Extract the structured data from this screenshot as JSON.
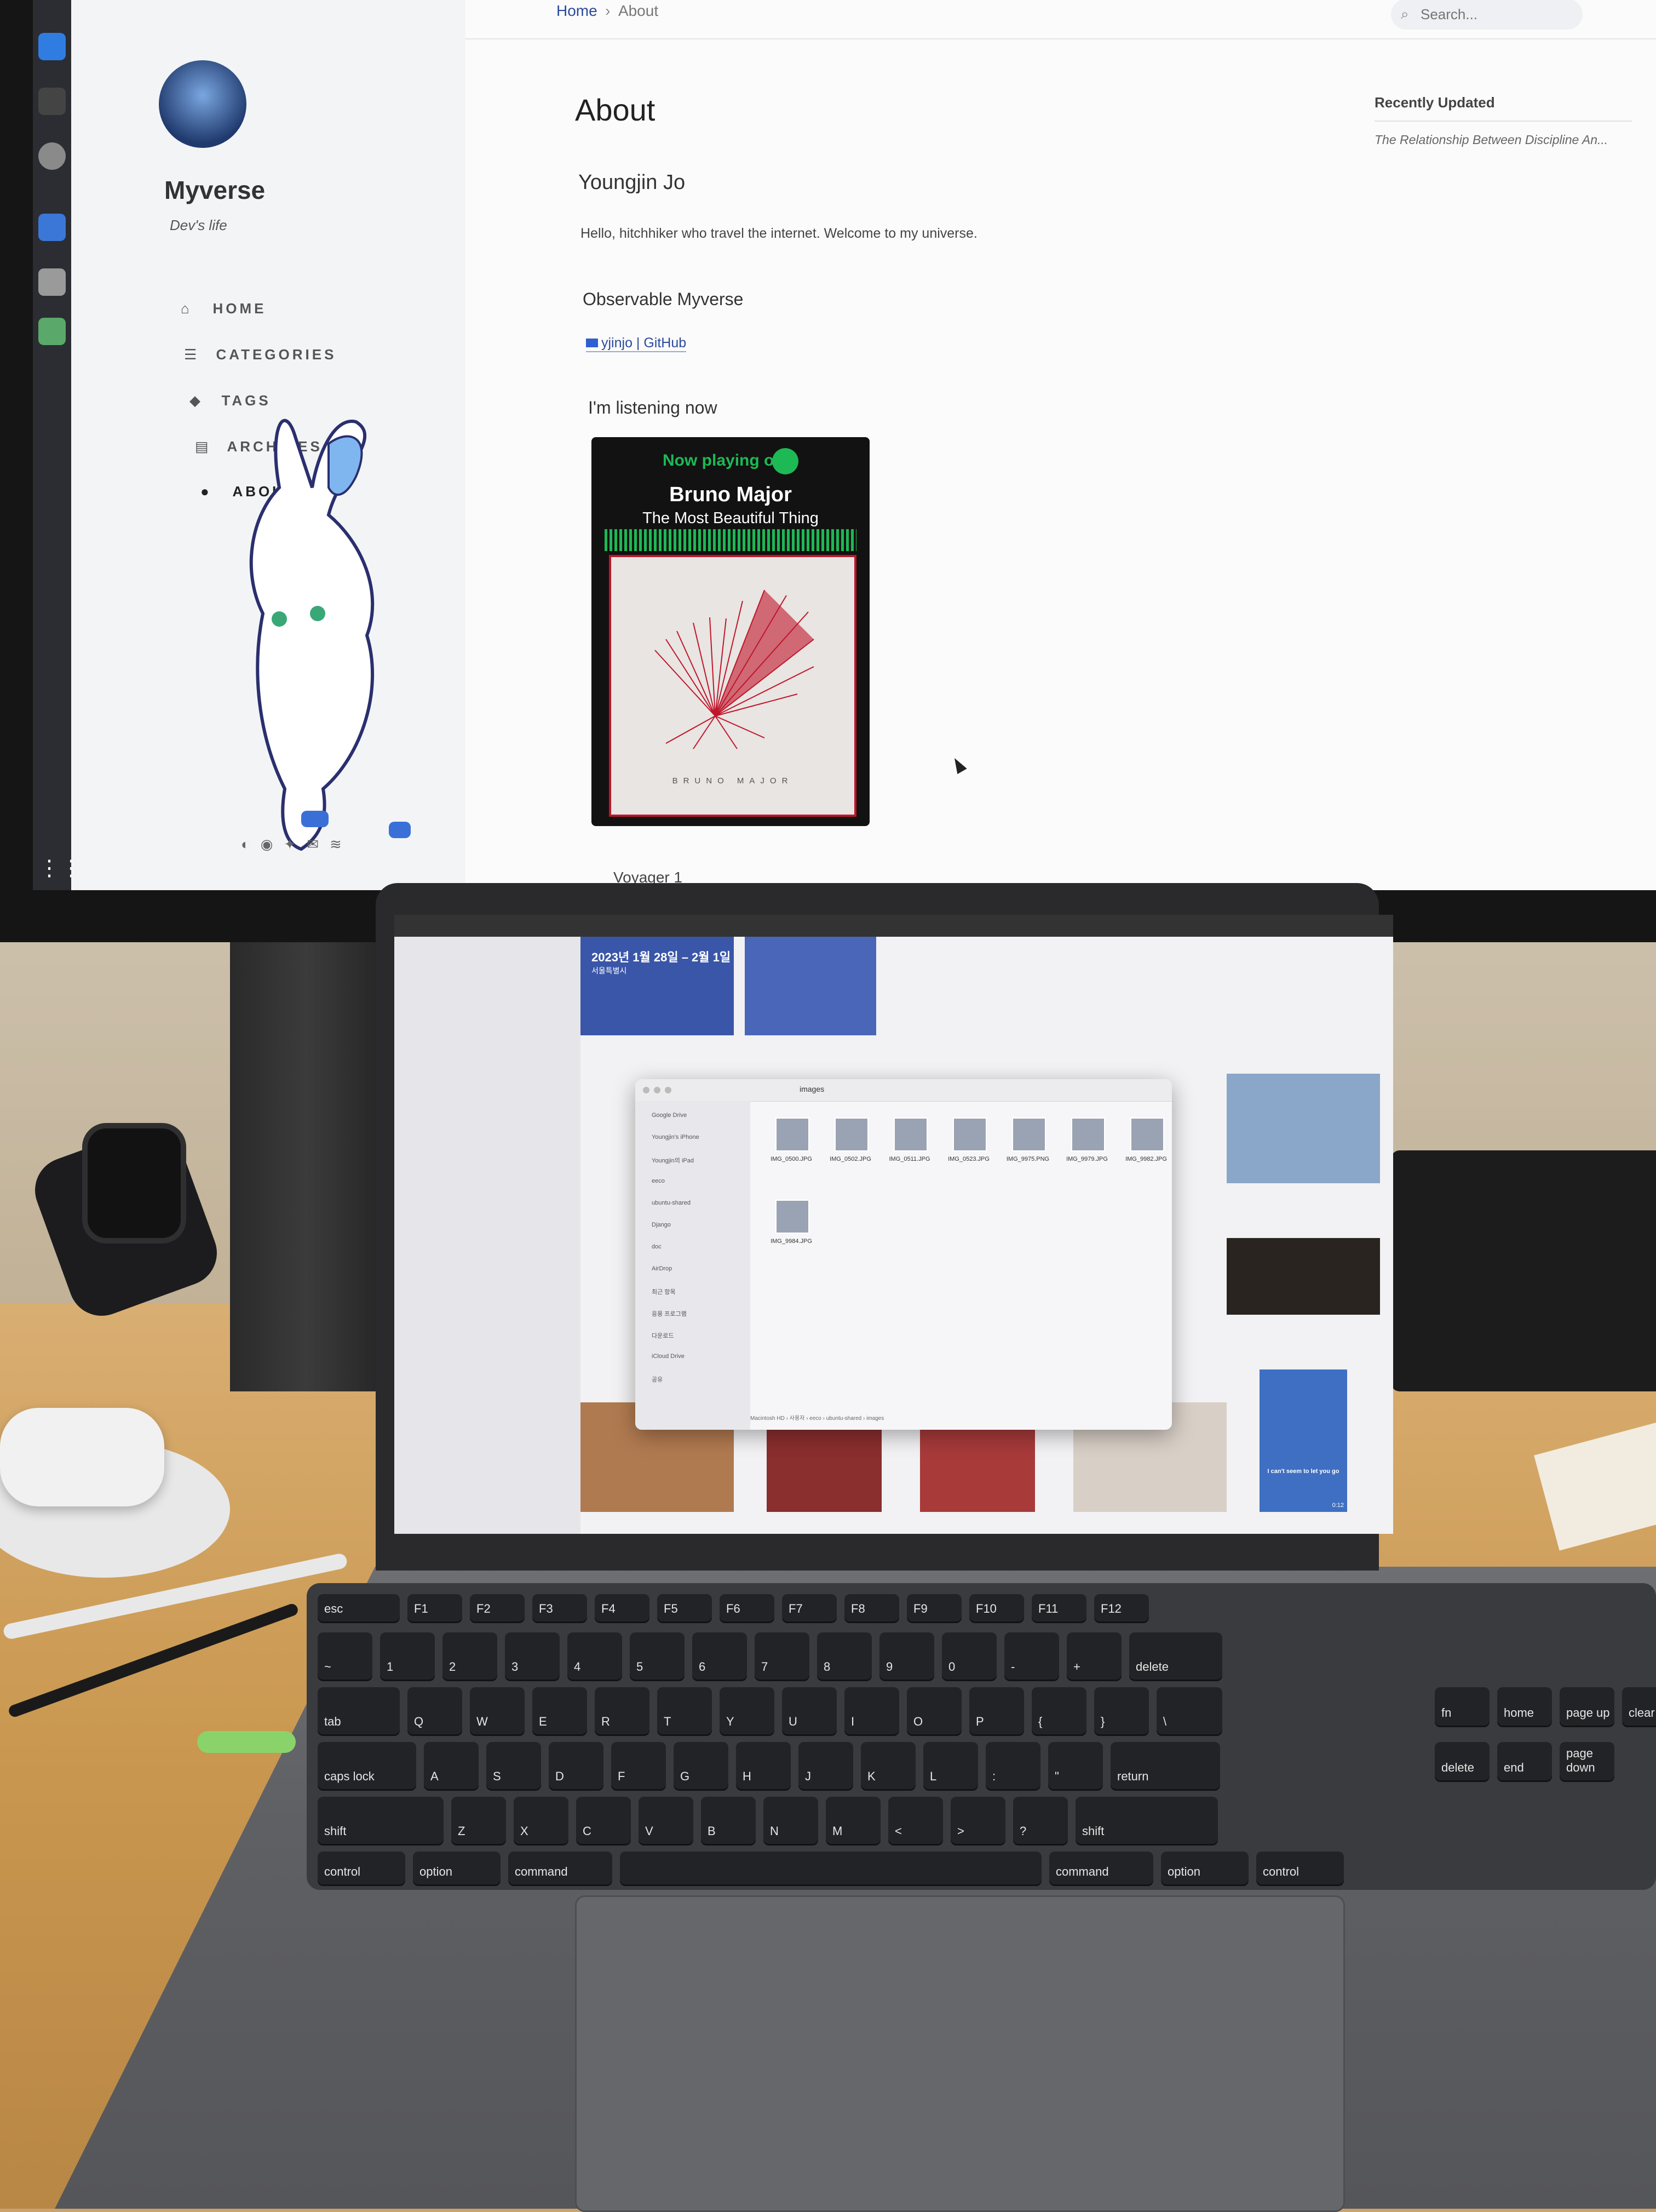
{
  "website": {
    "breadcrumb": {
      "home": "Home",
      "separator": "›",
      "current": "About"
    },
    "search": {
      "placeholder": "Search..."
    },
    "sidebar": {
      "site_title": "Myverse",
      "subtitle": "Dev's life",
      "nav": [
        {
          "label": "HOME",
          "icon": "home-icon"
        },
        {
          "label": "CATEGORIES",
          "icon": "list-icon"
        },
        {
          "label": "TAGS",
          "icon": "tag-icon"
        },
        {
          "label": "ARCHIVES",
          "icon": "archive-icon"
        },
        {
          "label": "ABOUT",
          "icon": "info-icon"
        }
      ]
    },
    "page_title": "About",
    "author_name": "Youngjin Jo",
    "intro": "Hello, hitchhiker who travel the internet. Welcome to my universe.",
    "observable_heading": "Observable Myverse",
    "github_link": "yjinjo | GitHub",
    "listening_heading": "I'm listening now",
    "spotify": {
      "now_playing": "Now playing on",
      "artist": "Bruno Major",
      "track": "The Most Beautiful Thing",
      "album_text": "BRUNO MAJOR",
      "accent_color": "#1db954"
    },
    "next_heading": "Voyager 1",
    "recently_updated_title": "Recently Updated",
    "recently_updated_item": "The Relationship Between Discipline An..."
  },
  "laptop": {
    "finder_header": {
      "date_range": "2023년 1월 28일 – 2월 1일",
      "location": "서울특별시"
    },
    "finder_sidebar": [
      "Google Drive",
      "Youngjin's iPhone",
      "Youngjin의 iPad",
      "eeco",
      "ubuntu-shared",
      "Django",
      "doc",
      "AirDrop",
      "최근 항목",
      "응용 프로그램",
      "다운로드",
      "iCloud Drive",
      "공유"
    ],
    "finder_window": {
      "title": "images",
      "files": [
        "IMG_0500.JPG",
        "IMG_0502.JPG",
        "IMG_0511.JPG",
        "IMG_0523.JPG",
        "IMG_9975.PNG",
        "IMG_9979.JPG",
        "IMG_9982.JPG",
        "IMG_9984.JPG"
      ],
      "path": "Macintosh HD › 사용자 › eeco › ubuntu-shared › images"
    },
    "video_caption": "I can't seem to let you go",
    "video_time": "0:12"
  },
  "keyboard": {
    "row_fn": [
      "esc",
      "F1",
      "F2",
      "F3",
      "F4",
      "F5",
      "F6",
      "F7",
      "F8",
      "F9",
      "F10",
      "F11",
      "F12"
    ],
    "row_num": [
      "~",
      "1",
      "2",
      "3",
      "4",
      "5",
      "6",
      "7",
      "8",
      "9",
      "0",
      "-",
      "+",
      "delete"
    ],
    "row_q": [
      "tab",
      "Q",
      "W",
      "E",
      "R",
      "T",
      "Y",
      "U",
      "I",
      "O",
      "P",
      "{",
      "}",
      "\\"
    ],
    "row_a": [
      "caps lock",
      "A",
      "S",
      "D",
      "F",
      "G",
      "H",
      "J",
      "K",
      "L",
      ":",
      "\"",
      "return"
    ],
    "row_z": [
      "shift",
      "Z",
      "X",
      "C",
      "V",
      "B",
      "N",
      "M",
      "<",
      ">",
      "?",
      "shift"
    ],
    "row_mod": [
      "control",
      "option",
      "command",
      "",
      "command",
      "option",
      "control"
    ],
    "nav_keys": [
      "fn",
      "home",
      "page up",
      "clear",
      "delete",
      "end",
      "page down"
    ]
  }
}
